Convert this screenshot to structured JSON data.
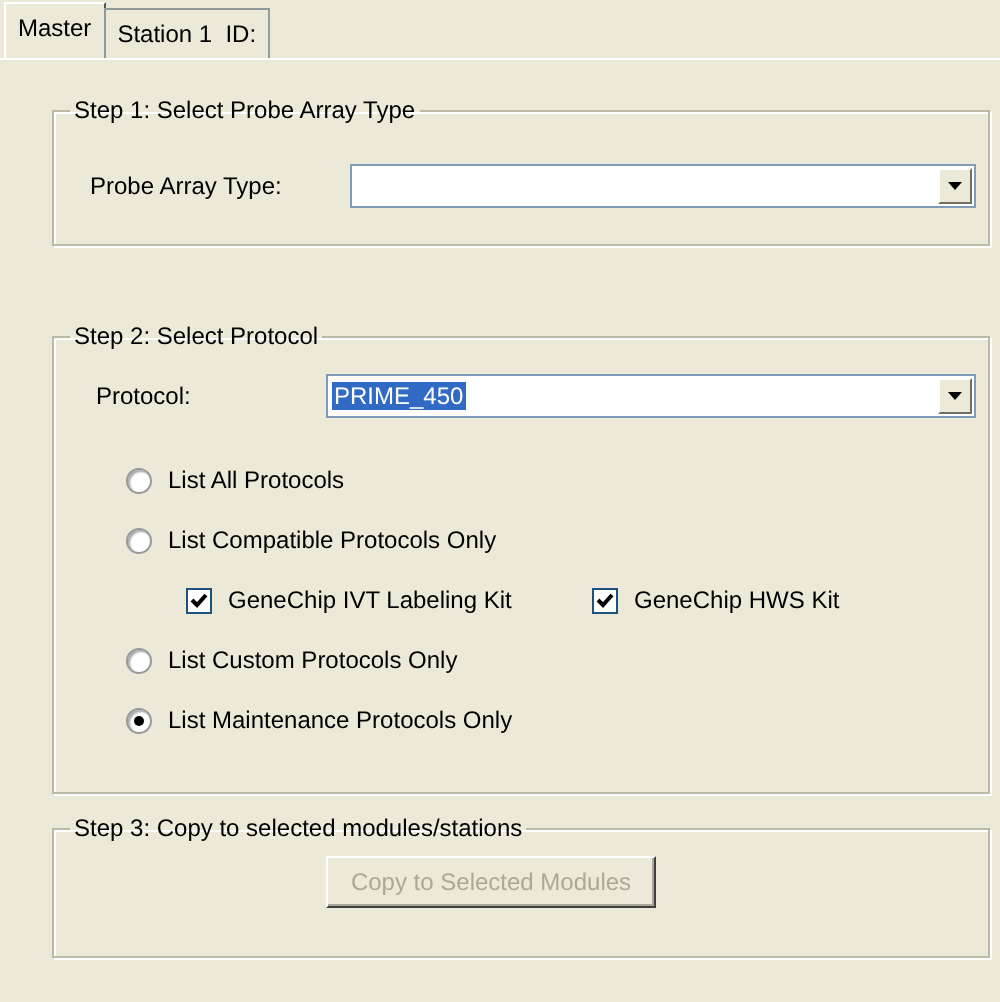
{
  "tabs": [
    {
      "label": "Master",
      "selected": true
    },
    {
      "label": "Station 1  ID:",
      "selected": false
    }
  ],
  "step1": {
    "legend": "Step 1: Select Probe Array Type",
    "label": "Probe Array Type:"
  },
  "step2": {
    "legend": "Step 2: Select Protocol",
    "label": "Protocol:",
    "value": "PRIME_450",
    "value_highlighted": true,
    "options": [
      {
        "kind": "radio",
        "label": "List All Protocols",
        "selected": false
      },
      {
        "kind": "radio",
        "label": "List Compatible Protocols Only",
        "selected": false
      },
      {
        "kind": "checks",
        "items": [
          {
            "label": "GeneChip IVT Labeling Kit",
            "checked": true
          },
          {
            "label": "GeneChip HWS Kit",
            "checked": true
          }
        ]
      },
      {
        "kind": "radio",
        "label": "List Custom Protocols Only",
        "selected": false
      },
      {
        "kind": "radio",
        "label": "List Maintenance Protocols Only",
        "selected": true
      }
    ]
  },
  "step3": {
    "legend": "Step 3: Copy to selected modules/stations",
    "button": {
      "label": "Copy to Selected Modules",
      "disabled": true
    }
  }
}
